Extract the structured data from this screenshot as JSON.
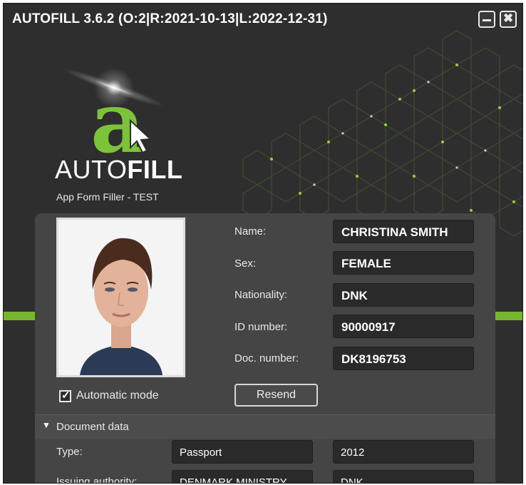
{
  "window": {
    "title": "AUTOFILL 3.6.2 (O:2|R:2021-10-13|L:2022-12-31)",
    "minimize_label": "",
    "close_label": "✖"
  },
  "brand": {
    "logo_letter": "a",
    "name_light": "AUTO",
    "name_bold": "FILL",
    "subtitle": "App Form Filler - TEST"
  },
  "fields": [
    {
      "label": "Name:",
      "value": "CHRISTINA SMITH"
    },
    {
      "label": "Sex:",
      "value": "FEMALE"
    },
    {
      "label": "Nationality:",
      "value": "DNK"
    },
    {
      "label": "ID number:",
      "value": "90000917"
    },
    {
      "label": "Doc. number:",
      "value": "DK8196753"
    }
  ],
  "automatic_mode": {
    "label": "Automatic mode",
    "checked": true,
    "check_glyph": "✓"
  },
  "resend_label": "Resend",
  "document_section": {
    "toggle_glyph": "▼",
    "title": "Document data",
    "rows": [
      {
        "label": "Type:",
        "value1": "Passport",
        "value2": "2012"
      },
      {
        "label": "Issuing authority:",
        "value1": "DENMARK MINISTRY",
        "value2": "DNK"
      }
    ]
  },
  "colors": {
    "background": "#2e2e2e",
    "panel": "#454545",
    "accent_green": "#78b52f",
    "field_bg": "#2a2a2a",
    "text": "#ffffff"
  }
}
